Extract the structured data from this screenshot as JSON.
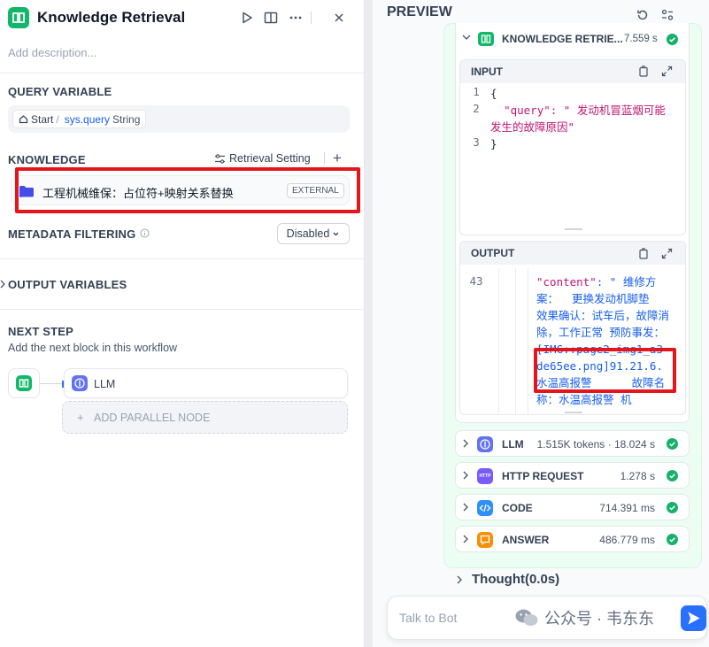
{
  "node_panel": {
    "title": "Knowledge Retrieval",
    "description_placeholder": "Add description...",
    "query_variable": {
      "label": "QUERY VARIABLE",
      "source_node": "Start",
      "separator": "/",
      "variable": "sys.query",
      "type": "String"
    },
    "knowledge": {
      "label": "KNOWLEDGE",
      "retrieval_setting": "Retrieval Setting",
      "add": "+",
      "item_name": "工程机械维保：占位符+映射关系替换",
      "item_badge": "EXTERNAL"
    },
    "metadata_filtering": {
      "label": "METADATA FILTERING",
      "value": "Disabled"
    },
    "output_variables": {
      "label": "OUTPUT VARIABLES"
    },
    "next_step": {
      "label": "NEXT STEP",
      "description": "Add the next block in this workflow",
      "next_node": "LLM",
      "add_parallel": "ADD PARALLEL NODE"
    }
  },
  "preview": {
    "title": "PREVIEW",
    "current_node": {
      "label": "KNOWLEDGE RETRIE...",
      "time": "7.559 s"
    },
    "input": {
      "label": "INPUT",
      "lines": [
        "{",
        "  \"query\": \" 发动机冒蓝烟可能发生的故障原因\"",
        "}"
      ],
      "line_numbers": [
        "1",
        "2",
        "3"
      ]
    },
    "output": {
      "label": "OUTPUT",
      "line_number": "43",
      "key": "\"content\"",
      "text_1": ": \" 维修方案：  更换发动机脚垫  效果确认：试车后，故障消除，工作正常 预防事发：",
      "highlight": "[IMG::page2_img1_a3de65ee.png]91.21.6.",
      "text_2": "水温高报警      故障名称：水温高报警 机"
    },
    "nodes": [
      {
        "label": "LLM",
        "time": "1.515K tokens · 18.024 s",
        "icon": "llm-icon",
        "color": "#6172f3"
      },
      {
        "label": "HTTP REQUEST",
        "time": "1.278 s",
        "icon": "http-icon",
        "color": "#7a5af8"
      },
      {
        "label": "CODE",
        "time": "714.391 ms",
        "icon": "code-icon",
        "color": "#2e90fa"
      },
      {
        "label": "ANSWER",
        "time": "486.779 ms",
        "icon": "answer-icon",
        "color": "#f79009"
      }
    ],
    "thought": "Thought(0.0s)",
    "chat_placeholder": "Talk to Bot",
    "watermark": "公众号 · 韦东东"
  },
  "colors": {
    "knowledge_green": "#12b76a",
    "success": "#17b26a",
    "highlight_red": "#e5161b",
    "link_blue": "#155eef",
    "send_blue": "#2970ff"
  }
}
